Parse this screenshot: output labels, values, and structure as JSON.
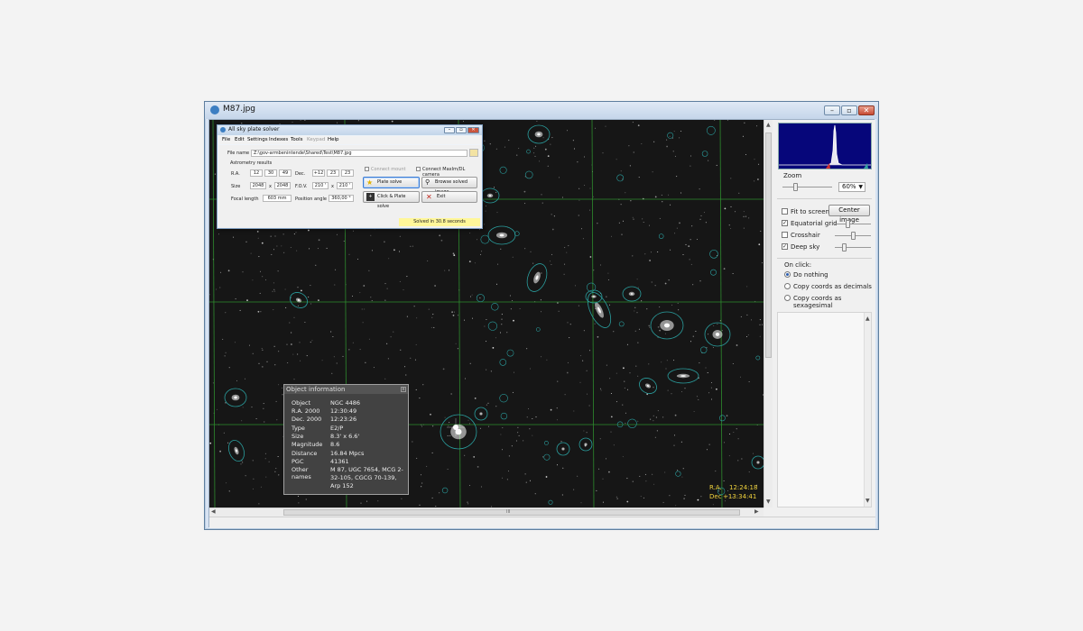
{
  "window": {
    "title": "M87.jpg",
    "controls": [
      "–",
      "▫",
      "✕"
    ]
  },
  "solver_dialog": {
    "title": "All sky plate solver",
    "controls": [
      "–",
      "▫",
      "✕"
    ],
    "menu": [
      "File",
      "Edit",
      "Settings",
      "Indexes",
      "Tools",
      "Keypad",
      "Help"
    ],
    "file_name_label": "File name",
    "file_name_value": "Z:\\gov-armbenintende\\Shared\\Test\\M87.jpg",
    "astrometry_label": "Astrometry results",
    "ra_label": "R.A.",
    "ra_h": "12",
    "ra_m": "30",
    "ra_s": "49",
    "dec_label": "Dec.",
    "dec_d": "+12",
    "dec_m": "23",
    "dec_s": "23",
    "size_label": "Size",
    "size_w": "2048",
    "size_x": "x",
    "size_h": "2048",
    "fov_label": "F.O.V.",
    "fov_w": "210 '",
    "fov_x": "x",
    "fov_h": "210 '",
    "focal_label": "Focal length",
    "focal_value": "603 mm",
    "pa_label": "Position angle",
    "pa_value": "360,00 °",
    "connect_mount": "Connect mount",
    "connect_camera": "Connect MaxIm/DL camera",
    "plate_solve": "Plate solve",
    "browse": "Browse solved image",
    "click_plate": "Click & Plate solve",
    "exit": "Exit",
    "status": "Solved in 30.8 seconds"
  },
  "object_info": {
    "title": "Object information",
    "close": "x",
    "rows": [
      {
        "k": "Object",
        "v": "NGC 4486"
      },
      {
        "k": "R.A. 2000",
        "v": "12:30:49"
      },
      {
        "k": "Dec. 2000",
        "v": "12:23:26"
      },
      {
        "k": "Type",
        "v": "E2/P"
      },
      {
        "k": "Size",
        "v": "8.3' x 6.6'"
      },
      {
        "k": "Magnitude",
        "v": "8.6"
      },
      {
        "k": "Distance",
        "v": "16.84 Mpcs"
      },
      {
        "k": "PGC",
        "v": "41361"
      },
      {
        "k": "Other names",
        "v": "M 87, UGC 7654, MCG 2-32-105, CGCG 70-139, Arp 152"
      }
    ]
  },
  "coords": {
    "ra_label": "R.A.",
    "ra": "12:24:18",
    "dec_label": "Dec",
    "dec": "+13:34:41"
  },
  "right_panel": {
    "zoom_label": "Zoom",
    "zoom_value": "60%",
    "fit_to_screen": "Fit to screen",
    "center_image": "Center image",
    "equatorial_grid": "Equatorial grid",
    "crosshair": "Crosshair",
    "deep_sky": "Deep sky",
    "on_click_label": "On click:",
    "on_click_options": [
      "Do nothing",
      "Copy coords as decimals",
      "Copy coords as sexagesimal"
    ],
    "checks": {
      "fit_to_screen": false,
      "equatorial_grid": true,
      "crosshair": false,
      "deep_sky": true
    },
    "selected_option": 0
  },
  "hscroll_mark": "III",
  "colors": {
    "grid": "#2e8b2e",
    "dso_ellipse": "#2a9e9e",
    "coords": "#f2d43c",
    "status": "#fff79a"
  }
}
